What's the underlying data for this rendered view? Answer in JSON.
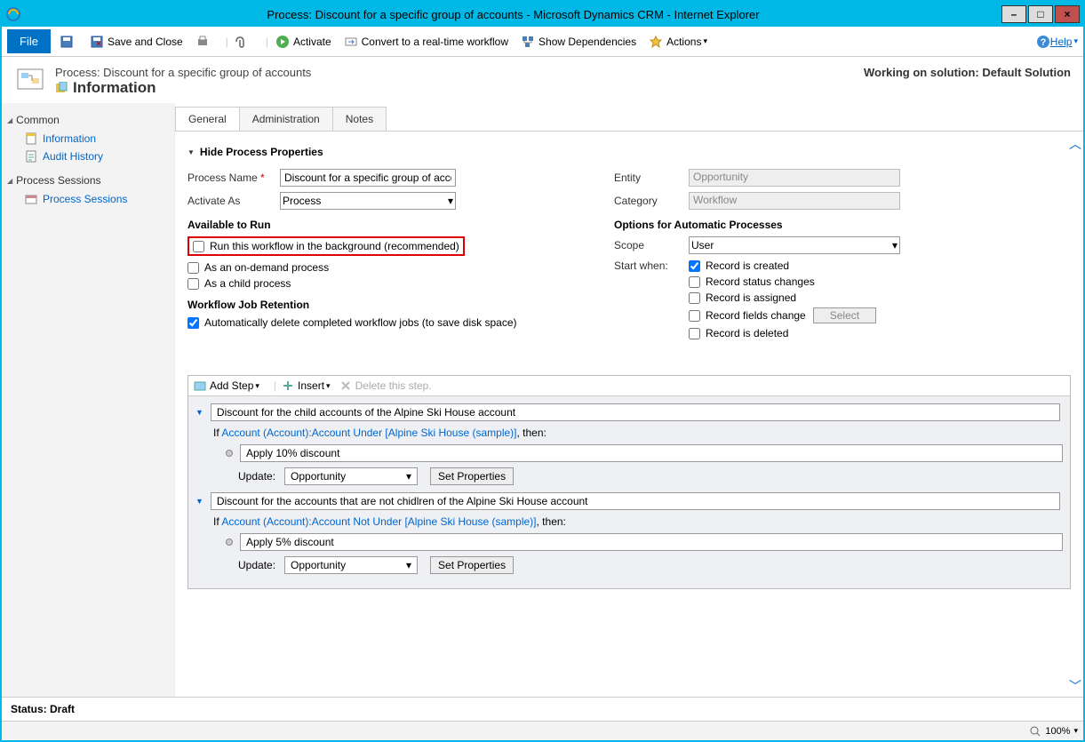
{
  "titlebar": {
    "title": "Process: Discount for a specific group of accounts - Microsoft Dynamics CRM - Internet Explorer"
  },
  "toolbar": {
    "file": "File",
    "save_close": "Save and Close",
    "activate": "Activate",
    "convert": "Convert to a real-time workflow",
    "deps": "Show Dependencies",
    "actions": "Actions",
    "help": "Help"
  },
  "header": {
    "breadcrumb": "Process: Discount for a specific group of accounts",
    "title": "Information",
    "solution_label": "Working on solution: Default Solution"
  },
  "sidebar": {
    "common": "Common",
    "information": "Information",
    "audit": "Audit History",
    "sessions_head": "Process Sessions",
    "sessions": "Process Sessions"
  },
  "tabs": {
    "general": "General",
    "admin": "Administration",
    "notes": "Notes"
  },
  "form": {
    "hide": "Hide Process Properties",
    "process_name_label": "Process Name",
    "process_name_value": "Discount for a specific group of accounts",
    "activate_as_label": "Activate As",
    "activate_as_value": "Process",
    "available_head": "Available to Run",
    "run_bg": "Run this workflow in the background (recommended)",
    "on_demand": "As an on-demand process",
    "child": "As a child process",
    "retention_head": "Workflow Job Retention",
    "auto_delete": "Automatically delete completed workflow jobs (to save disk space)",
    "entity_label": "Entity",
    "entity_value": "Opportunity",
    "category_label": "Category",
    "category_value": "Workflow",
    "options_head": "Options for Automatic Processes",
    "scope_label": "Scope",
    "scope_value": "User",
    "start_label": "Start when:",
    "sw_created": "Record is created",
    "sw_status": "Record status changes",
    "sw_assigned": "Record is assigned",
    "sw_fields": "Record fields change",
    "select_btn": "Select",
    "sw_deleted": "Record is deleted"
  },
  "wf": {
    "add_step": "Add Step",
    "insert": "Insert",
    "delete": "Delete this step.",
    "step1_title": "Discount for the child accounts of the Alpine Ski House account",
    "if1_pre": "If ",
    "if1_link": "Account (Account):Account Under [Alpine Ski House (sample)]",
    "if1_post": ", then:",
    "action1": "Apply 10% discount",
    "update_label": "Update:",
    "update_val": "Opportunity",
    "props_btn": "Set Properties",
    "step2_title": "Discount for the accounts that are not chidlren of the Alpine Ski House account",
    "if2_link": "Account (Account):Account Not Under [Alpine Ski House (sample)]",
    "action2": "Apply 5% discount"
  },
  "status": "Status: Draft",
  "zoom": "100%"
}
